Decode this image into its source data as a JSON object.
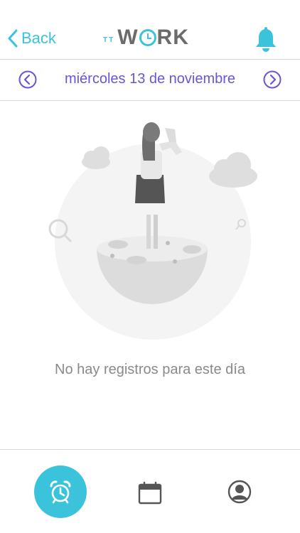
{
  "header": {
    "back_label": "Back",
    "logo_prefix": "TT",
    "logo_w": "W",
    "logo_rk": "RK",
    "notification_icon": "bell-icon",
    "accent_color": "#3cc3dc"
  },
  "date_nav": {
    "current_date": "miércoles 13 de noviembre",
    "prev_icon": "chevron-left-circle-icon",
    "next_icon": "chevron-right-circle-icon",
    "color": "#6b54d6"
  },
  "main": {
    "empty_message": "No hay registros para este día"
  },
  "tabbar": {
    "tabs": [
      {
        "icon": "alarm-clock-icon",
        "active": true
      },
      {
        "icon": "calendar-icon",
        "active": false
      },
      {
        "icon": "user-profile-icon",
        "active": false
      }
    ]
  }
}
